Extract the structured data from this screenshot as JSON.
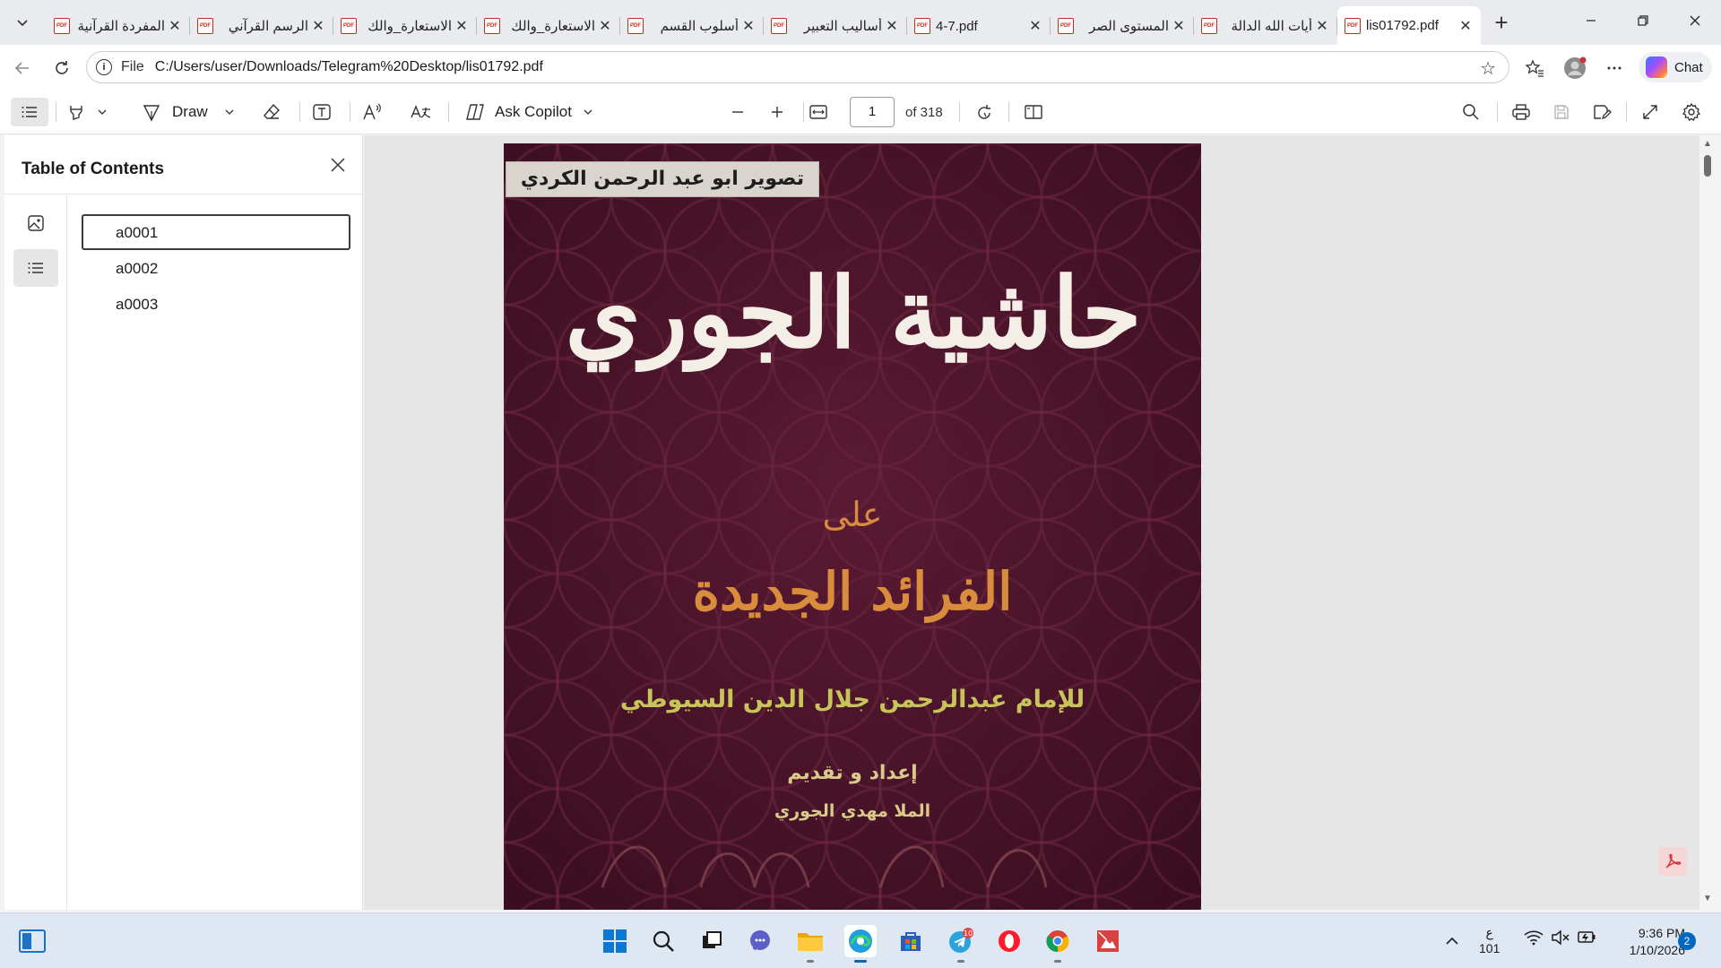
{
  "browser": {
    "tabs": [
      {
        "title": "المفردة القرآنية",
        "active": false
      },
      {
        "title": "الرسم القرآني",
        "active": false
      },
      {
        "title": "الاستعارة_والك",
        "active": false
      },
      {
        "title": "الاستعارة_والك",
        "active": false
      },
      {
        "title": "أسلوب القسم",
        "active": false
      },
      {
        "title": "أساليب التعبير",
        "active": false
      },
      {
        "title": "4-7.pdf",
        "active": false
      },
      {
        "title": "المستوى الصر",
        "active": false
      },
      {
        "title": "أيات الله الدالة",
        "active": false
      },
      {
        "title": "lis01792.pdf",
        "active": true
      }
    ],
    "address": {
      "scheme_label": "File",
      "url": "C:/Users/user/Downloads/Telegram%20Desktop/lis01792.pdf"
    },
    "copilot_label": "Chat"
  },
  "pdf_toolbar": {
    "draw_label": "Draw",
    "ask_copilot_label": "Ask Copilot",
    "page_number": "1",
    "page_total": "of 318"
  },
  "toc": {
    "title": "Table of Contents",
    "items": [
      {
        "label": "a0001",
        "selected": true
      },
      {
        "label": "a0002",
        "selected": false
      },
      {
        "label": "a0003",
        "selected": false
      }
    ]
  },
  "document": {
    "stamp": "تصوير ابو عبد الرحمن الكردي",
    "title": "حاشية الجوري",
    "ala": "على",
    "subtitle": "الفرائد الجديدة",
    "author": "للإمام عبدالرحمن جلال الدين السيوطي",
    "preparation": "إعداد و تقديم",
    "editor": "الملا مهدي الجوري",
    "colors": {
      "cover": "#4a1428",
      "title": "#f4efe6",
      "subtitle": "#d98c3c",
      "author": "#c7c45a"
    }
  },
  "taskbar": {
    "telegram_badge": "10",
    "lang_line1": "ع",
    "lang_line2": "101",
    "time": "9:36 PM",
    "date": "1/10/2026",
    "notifications": "2"
  }
}
